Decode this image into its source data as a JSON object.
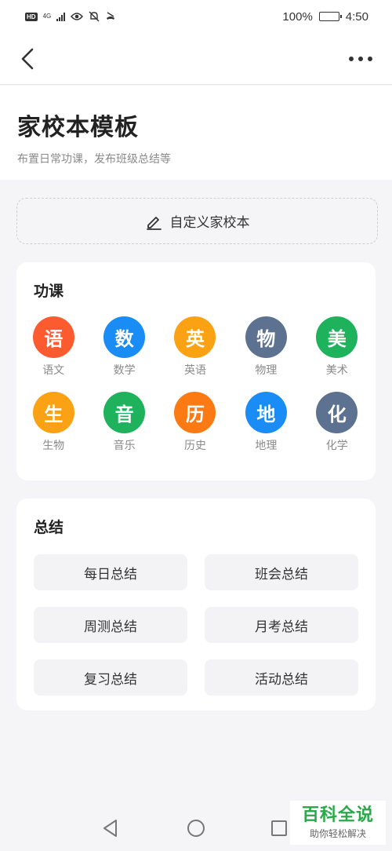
{
  "status_bar": {
    "hd_label": "HD",
    "network_label": "4G",
    "battery_text": "100%",
    "battery_level": 1.0,
    "time": "4:50"
  },
  "header": {
    "back_icon": "chevron-left-icon",
    "more_icon": "more-horizontal-icon"
  },
  "page": {
    "title": "家校本模板",
    "subtitle": "布置日常功课，发布班级总结等"
  },
  "custom_button": {
    "label": "自定义家校本",
    "icon": "pencil-icon"
  },
  "homework": {
    "title": "功课",
    "subjects": [
      {
        "char": "语",
        "label": "语文",
        "color": "#fb5b2f"
      },
      {
        "char": "数",
        "label": "数学",
        "color": "#1a8cf5"
      },
      {
        "char": "英",
        "label": "英语",
        "color": "#fba114"
      },
      {
        "char": "物",
        "label": "物理",
        "color": "#5d7291"
      },
      {
        "char": "美",
        "label": "美术",
        "color": "#1db25b"
      },
      {
        "char": "生",
        "label": "生物",
        "color": "#fba114"
      },
      {
        "char": "音",
        "label": "音乐",
        "color": "#1db25b"
      },
      {
        "char": "历",
        "label": "历史",
        "color": "#fb7a14"
      },
      {
        "char": "地",
        "label": "地理",
        "color": "#1a8cf5"
      },
      {
        "char": "化",
        "label": "化学",
        "color": "#5d7291"
      }
    ]
  },
  "summary": {
    "title": "总结",
    "items": [
      "每日总结",
      "班会总结",
      "周测总结",
      "月考总结",
      "复习总结",
      "活动总结"
    ]
  },
  "nav_bar": {
    "back_icon": "triangle-back-icon",
    "home_icon": "circle-home-icon",
    "recent_icon": "square-recent-icon"
  },
  "watermark": {
    "main": "百科全说",
    "sub": "助你轻松解决"
  }
}
